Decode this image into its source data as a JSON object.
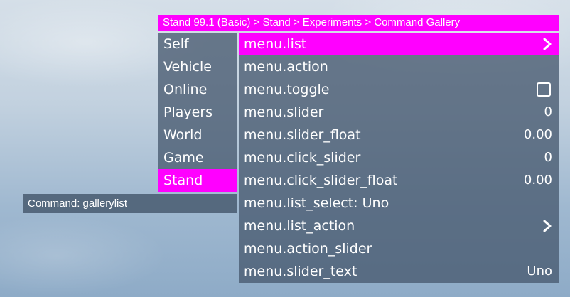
{
  "breadcrumb": "Stand 99.1 (Basic) > Stand > Experiments > Command Gallery",
  "sidebar": {
    "items": [
      {
        "label": "Self",
        "active": false
      },
      {
        "label": "Vehicle",
        "active": false
      },
      {
        "label": "Online",
        "active": false
      },
      {
        "label": "Players",
        "active": false
      },
      {
        "label": "World",
        "active": false
      },
      {
        "label": "Game",
        "active": false
      },
      {
        "label": "Stand",
        "active": true
      }
    ]
  },
  "command": "Command: gallerylist",
  "menu": {
    "items": [
      {
        "label": "menu.list",
        "value": "",
        "icon": "chevron-right-icon",
        "active": true
      },
      {
        "label": "menu.action",
        "value": "",
        "icon": "",
        "active": false
      },
      {
        "label": "menu.toggle",
        "value": "",
        "icon": "checkbox-icon",
        "active": false
      },
      {
        "label": "menu.slider",
        "value": "0",
        "icon": "",
        "active": false
      },
      {
        "label": "menu.slider_float",
        "value": "0.00",
        "icon": "",
        "active": false
      },
      {
        "label": "menu.click_slider",
        "value": "0",
        "icon": "",
        "active": false
      },
      {
        "label": "menu.click_slider_float",
        "value": "0.00",
        "icon": "",
        "active": false
      },
      {
        "label": "menu.list_select: Uno",
        "value": "",
        "icon": "",
        "active": false
      },
      {
        "label": "menu.list_action",
        "value": "",
        "icon": "chevron-right-icon",
        "active": false
      },
      {
        "label": "menu.action_slider",
        "value": "",
        "icon": "",
        "active": false
      },
      {
        "label": "menu.slider_text",
        "value": "Uno",
        "icon": "",
        "active": false
      }
    ]
  },
  "colors": {
    "accent": "#ff00ff",
    "panel": "#485a70",
    "text": "#ffffff"
  }
}
